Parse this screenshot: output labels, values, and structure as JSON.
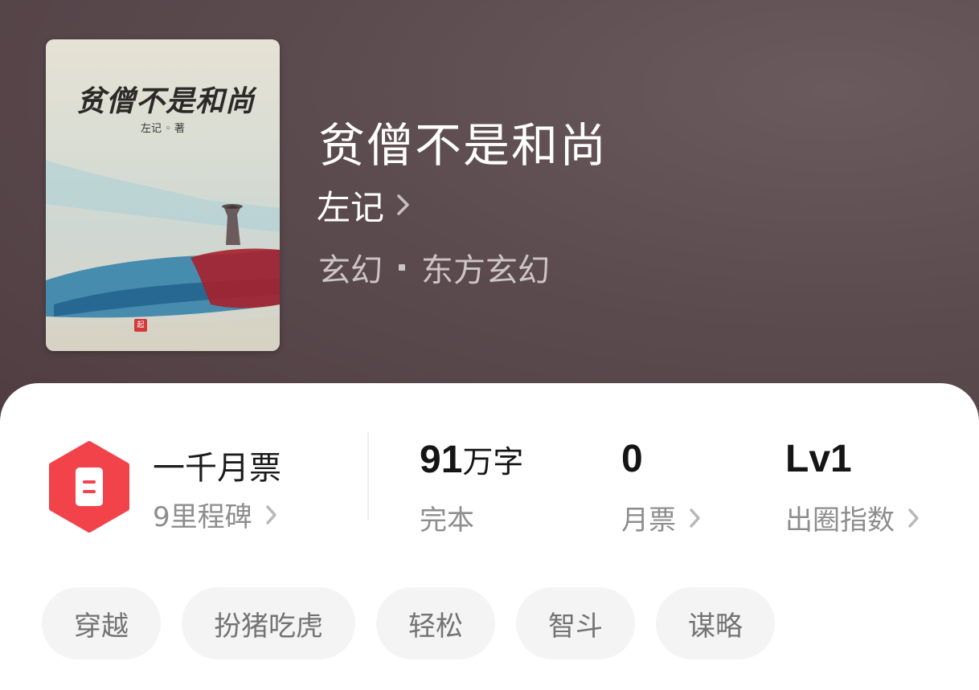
{
  "book": {
    "title": "贫僧不是和尚",
    "author": "左记",
    "genre": "玄幻",
    "subgenre": "东方玄幻",
    "cover": {
      "title": "贫僧不是和尚",
      "author_line": "左记 ◦ 著",
      "stamp": "起"
    }
  },
  "stats": {
    "ticket": {
      "title": "一千月票",
      "sub": "9里程碑",
      "icon": "ticket-icon",
      "color": "#f2434a"
    },
    "words": {
      "value": "91",
      "unit": "万字",
      "label": "完本"
    },
    "monthly_tickets": {
      "value": "0",
      "label": "月票"
    },
    "influence": {
      "value": "Lv1",
      "label": "出圈指数"
    }
  },
  "tags": [
    "穿越",
    "扮猪吃虎",
    "轻松",
    "智斗",
    "谋略"
  ]
}
